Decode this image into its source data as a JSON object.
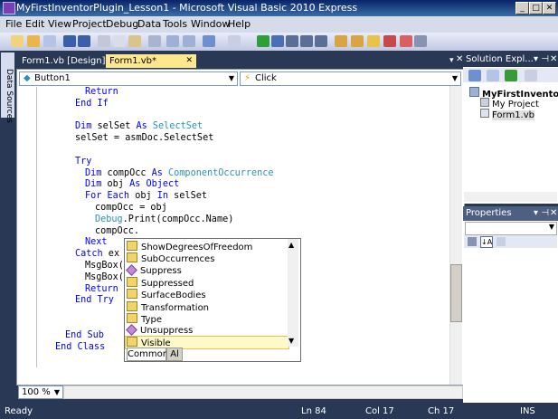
{
  "window": {
    "title": "MyFirstInventorPlugin_Lesson1 - Microsoft Visual Basic 2010 Express"
  },
  "menu": [
    "File",
    "Edit",
    "View",
    "Project",
    "Debug",
    "Data",
    "Tools",
    "Window",
    "Help"
  ],
  "left_strip": {
    "label": "Data Sources"
  },
  "tabs": [
    {
      "label": "Form1.vb [Design]*"
    },
    {
      "label": "Form1.vb*"
    }
  ],
  "editor": {
    "object_combo": "Button1",
    "event_combo": "Click",
    "lines": [
      {
        "indent": 2,
        "parts": [
          {
            "t": "Return",
            "c": "kw"
          }
        ]
      },
      {
        "indent": 1,
        "parts": [
          {
            "t": "End If",
            "c": "kw"
          }
        ]
      },
      {
        "indent": 1,
        "parts": [
          {
            "t": "",
            "c": ""
          }
        ]
      },
      {
        "indent": 1,
        "parts": [
          {
            "t": "Dim",
            "c": "kw"
          },
          {
            "t": " selSet ",
            "c": ""
          },
          {
            "t": "As",
            "c": "kw"
          },
          {
            "t": " ",
            "c": ""
          },
          {
            "t": "SelectSet",
            "c": "ty"
          }
        ]
      },
      {
        "indent": 1,
        "parts": [
          {
            "t": "selSet = asmDoc.SelectSet",
            "c": ""
          }
        ]
      },
      {
        "indent": 1,
        "parts": [
          {
            "t": "",
            "c": ""
          }
        ]
      },
      {
        "indent": 1,
        "parts": [
          {
            "t": "Try",
            "c": "kw"
          }
        ]
      },
      {
        "indent": 2,
        "parts": [
          {
            "t": "Dim",
            "c": "kw"
          },
          {
            "t": " compOcc ",
            "c": ""
          },
          {
            "t": "As",
            "c": "kw"
          },
          {
            "t": " ",
            "c": ""
          },
          {
            "t": "ComponentOccurrence",
            "c": "ty"
          }
        ]
      },
      {
        "indent": 2,
        "parts": [
          {
            "t": "Dim",
            "c": "kw"
          },
          {
            "t": " obj ",
            "c": ""
          },
          {
            "t": "As",
            "c": "kw"
          },
          {
            "t": " ",
            "c": ""
          },
          {
            "t": "Object",
            "c": "kw"
          }
        ]
      },
      {
        "indent": 2,
        "parts": [
          {
            "t": "For Each",
            "c": "kw"
          },
          {
            "t": " obj ",
            "c": ""
          },
          {
            "t": "In",
            "c": "kw"
          },
          {
            "t": " selSet",
            "c": ""
          }
        ]
      },
      {
        "indent": 3,
        "parts": [
          {
            "t": "compOcc = obj",
            "c": ""
          }
        ]
      },
      {
        "indent": 3,
        "parts": [
          {
            "t": "Debug",
            "c": "ty"
          },
          {
            "t": ".Print(compOcc.Name)",
            "c": ""
          }
        ]
      },
      {
        "indent": 3,
        "parts": [
          {
            "t": "compOcc.",
            "c": ""
          }
        ]
      },
      {
        "indent": 2,
        "parts": [
          {
            "t": "Next",
            "c": "kw"
          }
        ]
      },
      {
        "indent": 1,
        "parts": [
          {
            "t": "Catch",
            "c": "kw"
          },
          {
            "t": " ex ",
            "c": ""
          },
          {
            "t": "As",
            "c": "kw"
          }
        ]
      },
      {
        "indent": 2,
        "parts": [
          {
            "t": "MsgBox(\"Is",
            "c": ""
          }
        ]
      },
      {
        "indent": 2,
        "parts": [
          {
            "t": "MsgBox(ex.",
            "c": ""
          }
        ]
      },
      {
        "indent": 2,
        "parts": [
          {
            "t": "Return",
            "c": "kw"
          }
        ]
      },
      {
        "indent": 1,
        "parts": [
          {
            "t": "End Try",
            "c": "kw"
          }
        ]
      },
      {
        "indent": 1,
        "parts": [
          {
            "t": "",
            "c": ""
          }
        ]
      },
      {
        "indent": 1,
        "parts": [
          {
            "t": "",
            "c": ""
          }
        ]
      },
      {
        "indent": 0,
        "parts": [
          {
            "t": "End Sub",
            "c": "kw"
          }
        ]
      },
      {
        "indent": -1,
        "parts": [
          {
            "t": "End Class",
            "c": "kw"
          }
        ]
      }
    ],
    "zoom": "100 %"
  },
  "intellisense": {
    "items": [
      {
        "label": "ShowDegreesOfFreedom",
        "icon": "property-icon"
      },
      {
        "label": "SubOccurrences",
        "icon": "property-icon"
      },
      {
        "label": "Suppress",
        "icon": "method-icon"
      },
      {
        "label": "Suppressed",
        "icon": "property-icon"
      },
      {
        "label": "SurfaceBodies",
        "icon": "property-icon"
      },
      {
        "label": "Transformation",
        "icon": "property-icon"
      },
      {
        "label": "Type",
        "icon": "property-icon"
      },
      {
        "label": "Unsuppress",
        "icon": "method-icon"
      },
      {
        "label": "Visible",
        "icon": "property-icon"
      }
    ],
    "selected": "Visible",
    "tabs": [
      "Common",
      "Al"
    ]
  },
  "solution_explorer": {
    "title": "Solution Expl...",
    "project": "MyFirstInventorPl",
    "items": [
      "My Project",
      "Form1.vb"
    ]
  },
  "properties": {
    "title": "Properties"
  },
  "status": {
    "left": "Ready",
    "ln": "Ln 84",
    "col": "Col 17",
    "ch": "Ch 17",
    "mode": "INS"
  },
  "colors": {
    "keyword": "#0000ff",
    "type": "#2b91af",
    "selection": "#fff8c8",
    "chrome": "#293955"
  }
}
